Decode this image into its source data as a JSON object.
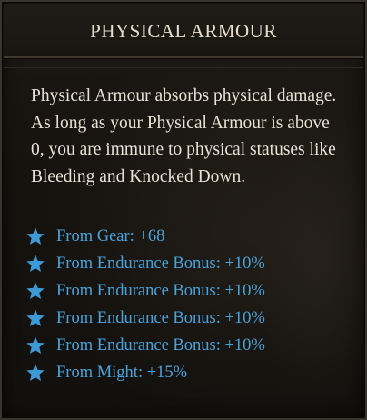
{
  "tooltip": {
    "title": "PHYSICAL ARMOUR",
    "description": "Physical Armour absorbs physical damage. As long as your Physical Armour is above 0, you are immune to physical statuses like Bleeding and Knocked Down.",
    "bonuses": [
      {
        "label": "From Gear: +68",
        "icon": "star-icon"
      },
      {
        "label": "From Endurance Bonus: +10%",
        "icon": "star-icon"
      },
      {
        "label": "From Endurance Bonus: +10%",
        "icon": "star-icon"
      },
      {
        "label": "From Endurance Bonus: +10%",
        "icon": "star-icon"
      },
      {
        "label": "From Endurance Bonus: +10%",
        "icon": "star-icon"
      },
      {
        "label": "From Might: +15%",
        "icon": "star-icon"
      }
    ]
  },
  "colors": {
    "title": "#e4ddd0",
    "description": "#e8e2d6",
    "bonus": "#4aa3dc",
    "star": "#3d9ad6"
  }
}
